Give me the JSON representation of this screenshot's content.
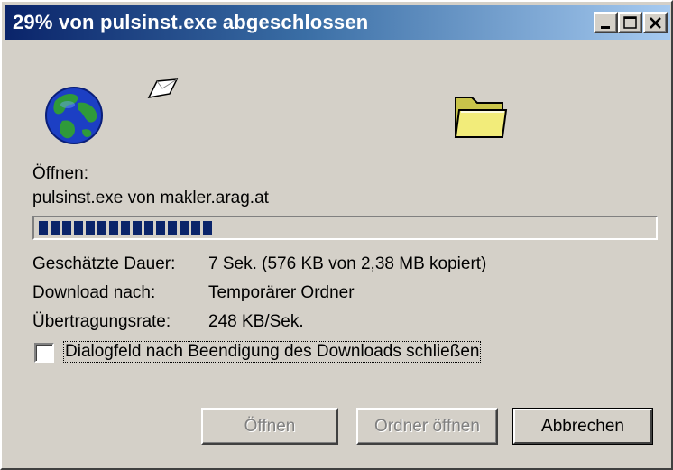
{
  "window": {
    "title": "29% von pulsinst.exe abgeschlossen",
    "minimize_label": "minimize",
    "maximize_label": "maximize",
    "close_label": "close"
  },
  "icons": {
    "globe": "globe-icon",
    "document": "flying-document-icon",
    "folder": "folder-icon"
  },
  "content": {
    "action_label": "Öffnen:",
    "file_info": "pulsinst.exe von makler.arag.at",
    "progress_percent": 29,
    "progress_color": "#0a246a",
    "details": [
      {
        "label": "Geschätzte Dauer:",
        "value": "7 Sek. (576 KB von 2,38 MB kopiert)"
      },
      {
        "label": "Download nach:",
        "value": "Temporärer Ordner"
      },
      {
        "label": "Übertragungsrate:",
        "value": "248 KB/Sek."
      }
    ],
    "close_checkbox": {
      "label": "Dialogfeld nach Beendigung des Downloads schließen",
      "checked": false
    }
  },
  "buttons": {
    "open": {
      "label": "Öffnen",
      "enabled": false
    },
    "open_folder": {
      "label": "Ordner öffnen",
      "enabled": false
    },
    "cancel": {
      "label": "Abbrechen",
      "enabled": true
    }
  }
}
